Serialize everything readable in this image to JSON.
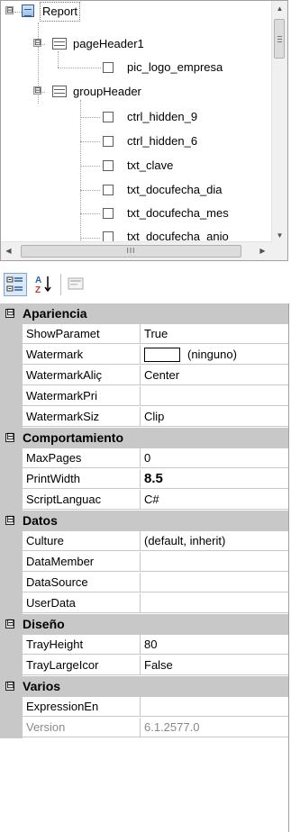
{
  "tree": {
    "nodes": [
      {
        "label": "Report",
        "type": "report",
        "expander": "⊟"
      },
      {
        "label": "pageHeader1",
        "type": "section",
        "expander": "⊟"
      },
      {
        "label": "pic_logo_empresa",
        "type": "node"
      },
      {
        "label": "groupHeader",
        "type": "section",
        "expander": "⊟"
      },
      {
        "label": "ctrl_hidden_9",
        "type": "node"
      },
      {
        "label": "ctrl_hidden_6",
        "type": "node"
      },
      {
        "label": "txt_clave",
        "type": "node"
      },
      {
        "label": "txt_docufecha_dia",
        "type": "node"
      },
      {
        "label": "txt_docufecha_mes",
        "type": "node"
      },
      {
        "label": "txt_docufecha_anio",
        "type": "node"
      }
    ],
    "hscroll_grip": "III"
  },
  "toolbar": {
    "categorized_icon": "categorized-icon",
    "alphabetical_icon": "sort-az-icon",
    "property_pages_icon": "property-pages-icon"
  },
  "grid": {
    "categories": [
      {
        "name": "Apariencia",
        "props": [
          {
            "name": "ShowParamet",
            "value": "True"
          },
          {
            "name": "Watermark",
            "value": "(ninguno)",
            "swatch": true
          },
          {
            "name": "WatermarkAliç",
            "value": "Center"
          },
          {
            "name": "WatermarkPri",
            "value": ""
          },
          {
            "name": "WatermarkSiz",
            "value": "Clip"
          }
        ]
      },
      {
        "name": "Comportamiento",
        "props": [
          {
            "name": "MaxPages",
            "value": "0"
          },
          {
            "name": "PrintWidth",
            "value": "8.5",
            "bold": true
          },
          {
            "name": "ScriptLanguac",
            "value": "C#"
          }
        ]
      },
      {
        "name": "Datos",
        "props": [
          {
            "name": "Culture",
            "value": "(default, inherit)"
          },
          {
            "name": "DataMember",
            "value": ""
          },
          {
            "name": "DataSource",
            "value": ""
          },
          {
            "name": "UserData",
            "value": ""
          }
        ]
      },
      {
        "name": "Diseño",
        "props": [
          {
            "name": "TrayHeight",
            "value": "80"
          },
          {
            "name": "TrayLargeIcor",
            "value": "False"
          }
        ]
      },
      {
        "name": "Varios",
        "props": [
          {
            "name": "ExpressionEn",
            "value": ""
          },
          {
            "name": "Version",
            "value": "6.1.2577.0",
            "dim": true
          }
        ]
      }
    ],
    "category_expander": "⊟"
  },
  "colors": {
    "category_bg": "#c8c8c8",
    "selection_border": "#7aa7d8"
  }
}
